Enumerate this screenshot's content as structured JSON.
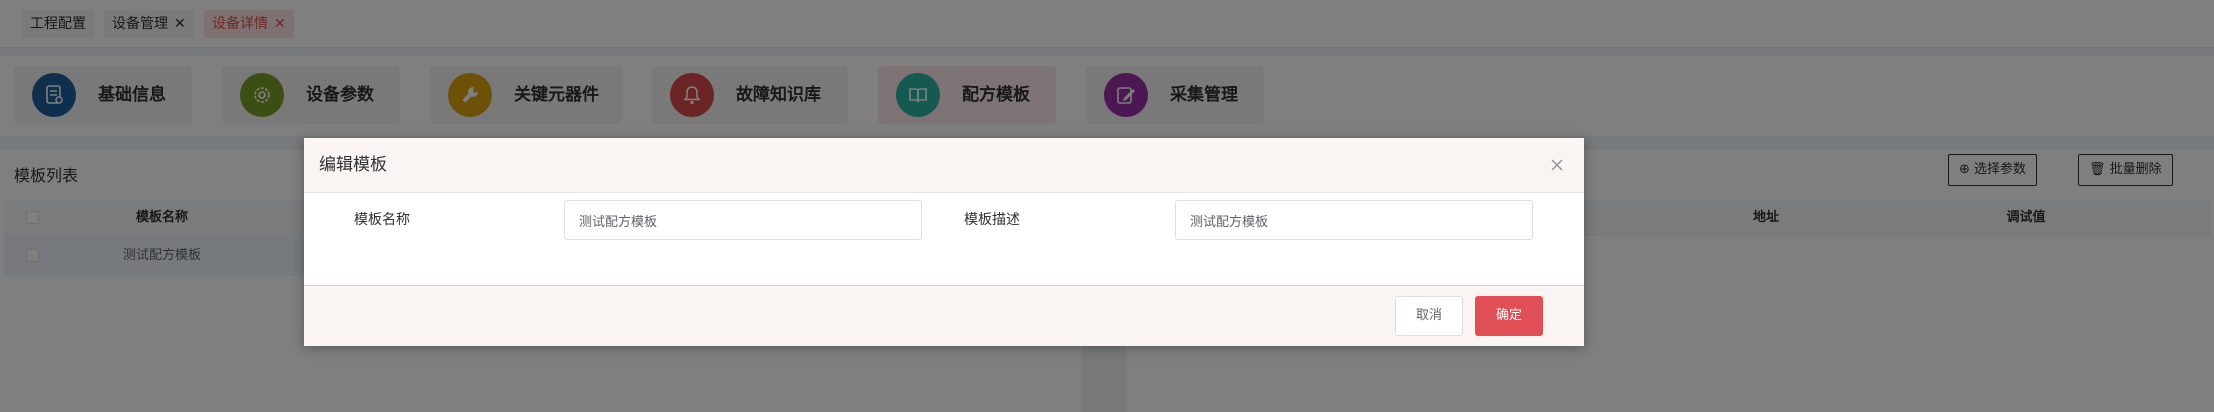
{
  "tabs": [
    {
      "label": "工程配置",
      "closable": false,
      "active": false
    },
    {
      "label": "设备管理",
      "closable": true,
      "active": false
    },
    {
      "label": "设备详情",
      "closable": true,
      "active": true
    }
  ],
  "nav": {
    "items": [
      {
        "label": "基础信息",
        "icon": "document-icon",
        "color": "#1f5f9f"
      },
      {
        "label": "设备参数",
        "icon": "gear-icon",
        "color": "#7a9c2a"
      },
      {
        "label": "关键元器件",
        "icon": "wrench-icon",
        "color": "#d8a30f"
      },
      {
        "label": "故障知识库",
        "icon": "bell-icon",
        "color": "#d84a4a"
      },
      {
        "label": "配方模板",
        "icon": "book-icon",
        "color": "#2bb3a6",
        "selected": true
      },
      {
        "label": "采集管理",
        "icon": "edit-icon",
        "color": "#9b2fa8"
      }
    ]
  },
  "left_panel": {
    "title": "模板列表",
    "columns": [
      "模板名称"
    ],
    "rows": [
      [
        "测试配方模板"
      ]
    ]
  },
  "right_panel": {
    "buttons": {
      "select_params": "选择参数",
      "batch_delete": "批量删除"
    },
    "columns": [
      "地址",
      "调试值"
    ]
  },
  "dialog": {
    "title": "编辑模板",
    "fields": {
      "name_label": "模板名称",
      "name_value": "测试配方模板",
      "desc_label": "模板描述",
      "desc_value": "测试配方模板"
    },
    "cancel_label": "取消",
    "confirm_label": "确定"
  },
  "colors": {
    "accent": "#e04f55",
    "mask": "rgba(0,0,0,0.5)"
  }
}
